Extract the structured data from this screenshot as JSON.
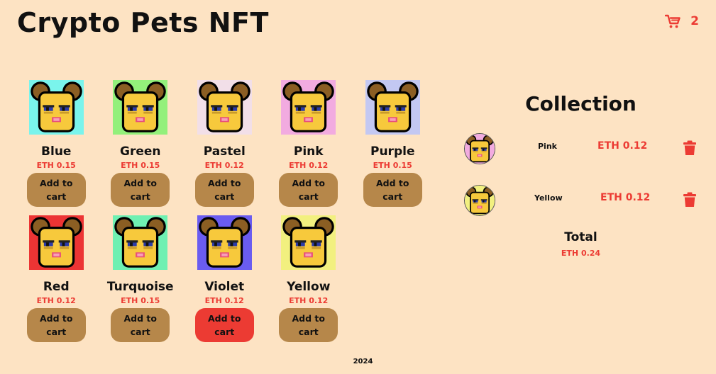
{
  "header": {
    "title": "Crypto Pets NFT",
    "cart_count": "2",
    "cart_icon": "shopping-cart-icon",
    "accent_color": "#ec3b33"
  },
  "products": [
    {
      "name": "Blue",
      "price": "ETH 0.15",
      "button_label": "Add to cart",
      "bg_color": "#7af4ec"
    },
    {
      "name": "Green",
      "price": "ETH 0.15",
      "button_label": "Add to cart",
      "bg_color": "#93f07b"
    },
    {
      "name": "Pastel",
      "price": "ETH 0.12",
      "button_label": "Add to cart",
      "bg_color": "#f2dfe8"
    },
    {
      "name": "Pink",
      "price": "ETH 0.12",
      "button_label": "Add to cart",
      "bg_color": "#f2abe0"
    },
    {
      "name": "Purple",
      "price": "ETH 0.15",
      "button_label": "Add to cart",
      "bg_color": "#c3c8f2"
    },
    {
      "name": "Red",
      "price": "ETH 0.12",
      "button_label": "Add to cart",
      "bg_color": "#ec3434"
    },
    {
      "name": "Turquoise",
      "price": "ETH 0.15",
      "button_label": "Add to cart",
      "bg_color": "#6ff0b2"
    },
    {
      "name": "Violet",
      "price": "ETH 0.12",
      "button_label": "Add to cart",
      "bg_color": "#6a5cf0",
      "active": true
    },
    {
      "name": "Yellow",
      "price": "ETH 0.12",
      "button_label": "Add to cart",
      "bg_color": "#f2f07f"
    }
  ],
  "collection": {
    "title": "Collection",
    "items": [
      {
        "name": "Pink",
        "price": "ETH 0.12",
        "bg_color": "#f2abe0",
        "remove_icon": "trash-icon"
      },
      {
        "name": "Yellow",
        "price": "ETH 0.12",
        "bg_color": "#f2f07f",
        "remove_icon": "trash-icon"
      }
    ],
    "total_label": "Total",
    "total_value": "ETH 0.24"
  },
  "footer": {
    "year": "2024"
  },
  "colors": {
    "page_bg": "#fde3c3",
    "button_bg": "#b6874a",
    "button_active_bg": "#ec3b33",
    "price_color": "#ec3b33"
  }
}
